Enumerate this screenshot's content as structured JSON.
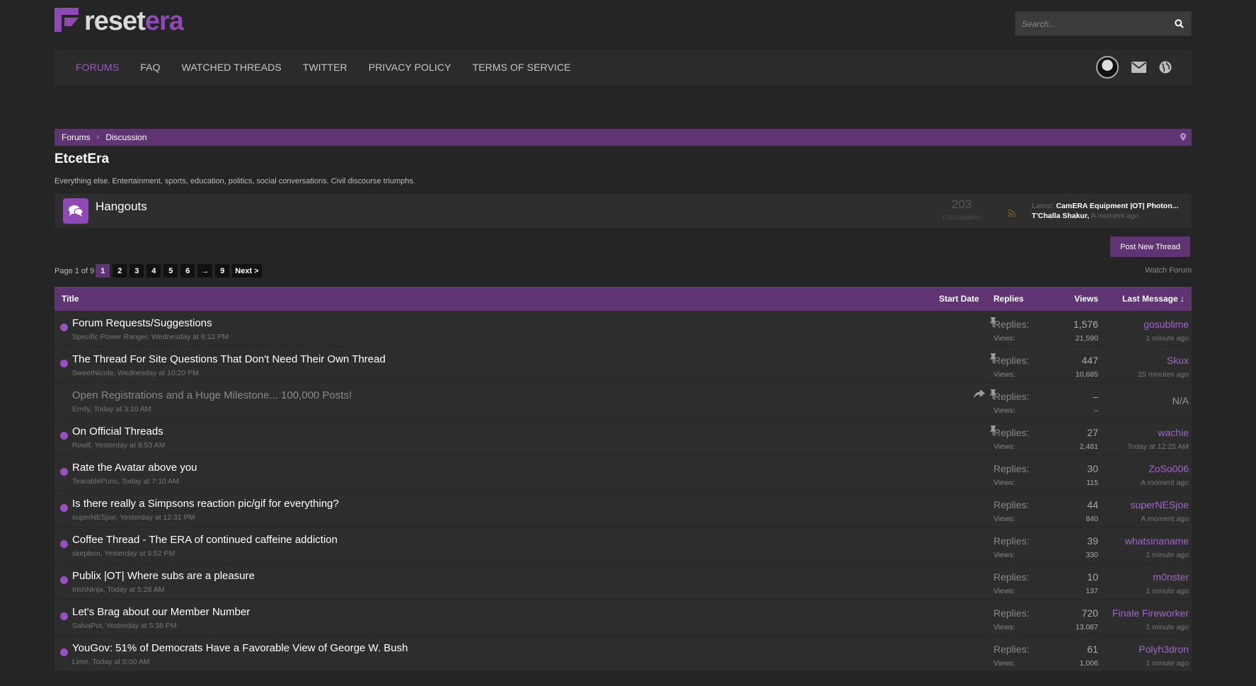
{
  "brand": {
    "name_part1": "reset",
    "name_part2": "era",
    "accent": "#8e49b5"
  },
  "search": {
    "placeholder": "Search..."
  },
  "nav": [
    "FORUMS",
    "FAQ",
    "WATCHED THREADS",
    "TWITTER",
    "PRIVACY POLICY",
    "TERMS OF SERVICE"
  ],
  "breadcrumb": [
    "Forums",
    "Discussion"
  ],
  "page": {
    "title": "EtcetEra",
    "description": "Everything else. Entertainment, sports, education, politics, social conversations. Civil discourse triumphs."
  },
  "subforum": {
    "name": "Hangouts",
    "count": "203",
    "count_label": "Discussions",
    "latest_label": "Latest:",
    "latest_title": "CamERA Equipment |OT| Photon...",
    "latest_user": "T'Challa Shakur,",
    "latest_time": "A moment ago"
  },
  "actions": {
    "post_new": "Post New Thread",
    "watch": "Watch Forum"
  },
  "pager": {
    "label": "Page 1 of 9",
    "pages": [
      "1",
      "2",
      "3",
      "4",
      "5",
      "6",
      "→",
      "9",
      "Next >"
    ],
    "current": "1"
  },
  "table": {
    "headers": {
      "title": "Title",
      "start_date": "Start Date",
      "replies": "Replies",
      "views": "Views",
      "last_message": "Last Message ↓"
    },
    "replies_label": "Replies:",
    "views_label": "Views:",
    "rows": [
      {
        "title": "Forum Requests/Suggestions",
        "meta": "Specific Power Ranger, Wednesday at 6:12 PM",
        "replies": "1,576",
        "views": "21,590",
        "last_user": "gosublime",
        "last_time": "1 minute ago",
        "sticky": true,
        "redirect": false,
        "unread": true
      },
      {
        "title": "The Thread For Site Questions That Don't Need Their Own Thread",
        "meta": "SweetNicole, Wednesday at 10:20 PM",
        "replies": "447",
        "views": "10,685",
        "last_user": "Skux",
        "last_time": "25 minutes ago",
        "sticky": true,
        "redirect": false,
        "unread": true
      },
      {
        "title": "Open Registrations and a Huge Milestone... 100,000 Posts!",
        "meta": "Emily, Today at 3:10 AM",
        "replies": "–",
        "views": "–",
        "last_user": "N/A",
        "last_time": "",
        "sticky": true,
        "redirect": true,
        "unread": false
      },
      {
        "title": "On Official Threads",
        "meta": "Rowlf, Yesterday at 9:53 AM",
        "replies": "27",
        "views": "2,481",
        "last_user": "wachie",
        "last_time": "Today at 12:25 AM",
        "sticky": true,
        "redirect": false,
        "unread": true
      },
      {
        "title": "Rate the Avatar above you",
        "meta": "TearablePuns, Today at 7:10 AM",
        "replies": "30",
        "views": "115",
        "last_user": "ZoSo006",
        "last_time": "A moment ago",
        "sticky": false,
        "redirect": false,
        "unread": true
      },
      {
        "title": "Is there really a Simpsons reaction pic/gif for everything?",
        "meta": "superNESjoe, Yesterday at 12:31 PM",
        "replies": "44",
        "views": "840",
        "last_user": "superNESjoe",
        "last_time": "A moment ago",
        "sticky": false,
        "redirect": false,
        "unread": true
      },
      {
        "title": "Coffee Thread - The ERA of continued caffeine addiction",
        "meta": "skeptem, Yesterday at 9:52 PM",
        "replies": "39",
        "views": "330",
        "last_user": "whatsinaname",
        "last_time": "1 minute ago",
        "sticky": false,
        "redirect": false,
        "unread": true
      },
      {
        "title": "Publix |OT| Where subs are a pleasure",
        "meta": "IrishNinja, Today at 5:28 AM",
        "replies": "10",
        "views": "137",
        "last_user": "m0nster",
        "last_time": "1 minute ago",
        "sticky": false,
        "redirect": false,
        "unread": true
      },
      {
        "title": "Let's Brag about our Member Number",
        "meta": "SalvaPot, Yesterday at 5:38 PM",
        "replies": "720",
        "views": "13,087",
        "last_user": "Finale Fireworker",
        "last_time": "1 minute ago",
        "sticky": false,
        "redirect": false,
        "unread": true
      },
      {
        "title": "YouGov: 51% of Democrats Have a Favorable View of George W. Bush",
        "meta": "Lime, Today at 5:00 AM",
        "replies": "61",
        "views": "1,006",
        "last_user": "Polyh3dron",
        "last_time": "1 minute ago",
        "sticky": false,
        "redirect": false,
        "unread": true
      }
    ]
  }
}
